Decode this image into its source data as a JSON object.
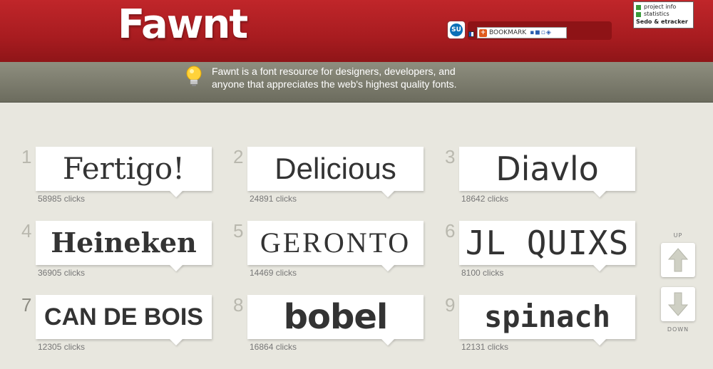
{
  "header": {
    "logo": "Fawnt",
    "stumble_label": "SU",
    "bookmark_label": "BOOKMARK",
    "etracker": {
      "line1": "project info",
      "line2": "statistics",
      "brand": "Sedo & etracker"
    }
  },
  "banner": {
    "tagline_line1": "Fawnt is a font resource for designers, developers, and",
    "tagline_line2": "anyone that appreciates the web's highest quality fonts."
  },
  "fonts": [
    {
      "rank": "1",
      "name": "Fertigo!",
      "clicks": "58985 clicks"
    },
    {
      "rank": "2",
      "name": "Delicious",
      "clicks": "24891 clicks"
    },
    {
      "rank": "3",
      "name": "Diavlo",
      "clicks": "18642 clicks"
    },
    {
      "rank": "4",
      "name": "Heineken",
      "clicks": "36905 clicks"
    },
    {
      "rank": "5",
      "name": "GERONTO",
      "clicks": "14469 clicks"
    },
    {
      "rank": "6",
      "name": "JL QUIXS",
      "clicks": "8100 clicks"
    },
    {
      "rank": "7",
      "name": "CAN DE BOIS",
      "clicks": "12305 clicks"
    },
    {
      "rank": "8",
      "name": "bobel",
      "clicks": "16864 clicks"
    },
    {
      "rank": "9",
      "name": "spinach",
      "clicks": "12131 clicks"
    }
  ],
  "nav": {
    "up_label": "UP",
    "down_label": "DOWN"
  },
  "colors": {
    "header_red": "#b01e22",
    "banner_gray": "#7c7c6e",
    "page_bg": "#e8e7df",
    "sample_text": "#333333"
  }
}
